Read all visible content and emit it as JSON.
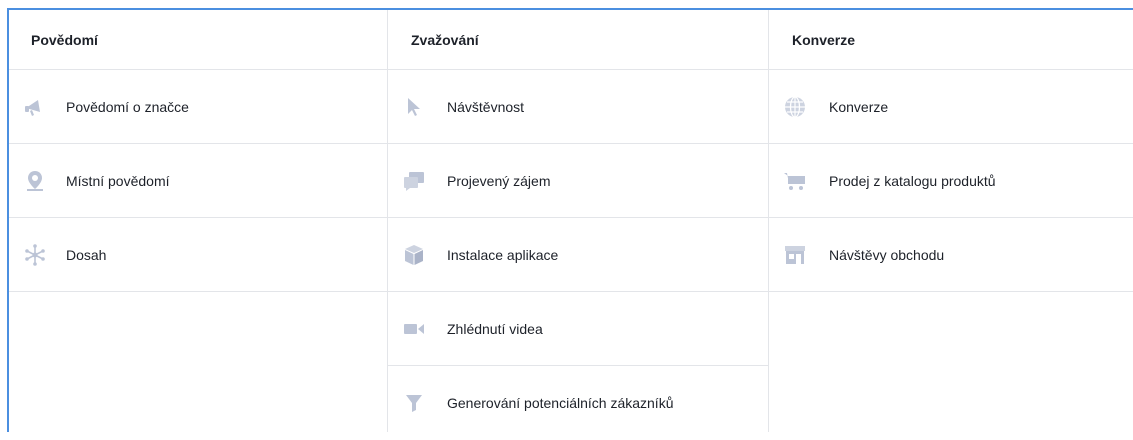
{
  "colors": {
    "border_accent": "#4b8fe0",
    "icon": "#bcc4d6",
    "divider": "#e3e5e9"
  },
  "columns": [
    {
      "header": "Povědomí",
      "items": [
        {
          "label": "Povědomí o značce",
          "icon": "megaphone-icon"
        },
        {
          "label": "Místní povědomí",
          "icon": "location-pin-icon"
        },
        {
          "label": "Dosah",
          "icon": "network-icon"
        }
      ]
    },
    {
      "header": "Zvažování",
      "items": [
        {
          "label": "Návštěvnost",
          "icon": "cursor-icon"
        },
        {
          "label": "Projevený zájem",
          "icon": "chat-bubbles-icon"
        },
        {
          "label": "Instalace aplikace",
          "icon": "box-icon"
        },
        {
          "label": "Zhlédnutí videa",
          "icon": "video-camera-icon"
        },
        {
          "label": "Generování potenciálních zákazníků",
          "icon": "funnel-icon"
        }
      ]
    },
    {
      "header": "Konverze",
      "items": [
        {
          "label": "Konverze",
          "icon": "globe-icon"
        },
        {
          "label": "Prodej z katalogu produktů",
          "icon": "shopping-cart-icon"
        },
        {
          "label": "Návštěvy obchodu",
          "icon": "store-icon"
        }
      ]
    }
  ]
}
